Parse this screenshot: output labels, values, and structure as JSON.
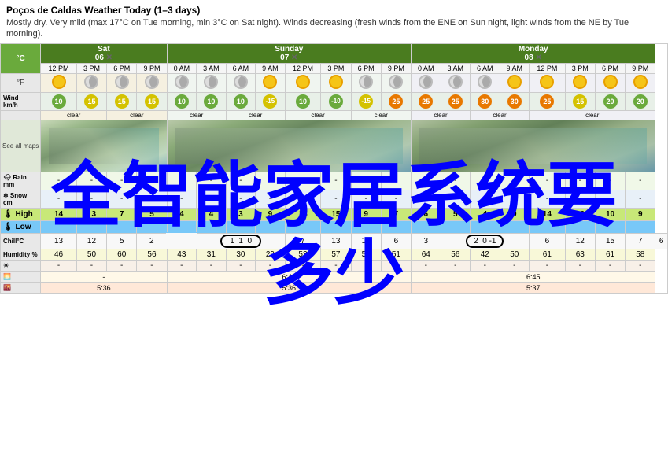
{
  "header": {
    "title": "Poços de Caldas Weather Today (1–3 days)",
    "description": "Mostly dry. Very mild (max 17°C on Tue morning, min 3°C on Sat night). Winds decreasing (fresh winds from the ENE on Sun night, light winds from the NE by Tue morning)."
  },
  "units": {
    "celsius": "°C",
    "fahrenheit": "°F"
  },
  "days": [
    {
      "name": "Sat",
      "date": "06"
    },
    {
      "name": "Sunday",
      "date": "07"
    },
    {
      "name": "Monday",
      "date": "08"
    }
  ],
  "sat_times": [
    "12 PM",
    "3 PM",
    "6 PM",
    "9 PM"
  ],
  "sun_times": [
    "0 AM",
    "3 AM",
    "6 AM",
    "9 AM",
    "12 PM",
    "3 PM",
    "6 PM",
    "9 PM"
  ],
  "mon_times": [
    "0 AM",
    "3 AM",
    "6 AM",
    "9 AM",
    "12 PM",
    "3 PM",
    "6 PM",
    "9 PM"
  ],
  "wind_sat": [
    "10",
    "15",
    "15",
    "15"
  ],
  "wind_sun": [
    "10",
    "10",
    "10",
    "-15",
    "10",
    "-10",
    "-15",
    "25"
  ],
  "wind_mon": [
    "25",
    "25",
    "30",
    "30",
    "25",
    "15",
    "20",
    "20"
  ],
  "rain_sat": [
    "-",
    "-",
    "-",
    "-"
  ],
  "rain_sun": [
    "-",
    "-",
    "-",
    "-",
    "-",
    "-",
    "-",
    "-"
  ],
  "rain_mon": [
    "-",
    "-",
    "-",
    "-",
    "-",
    "-",
    "-",
    "-"
  ],
  "snow_sat": [
    "-",
    "-",
    "-",
    "-"
  ],
  "snow_sun": [
    "-",
    "-",
    "-",
    "-",
    "-",
    "-",
    "-",
    "-"
  ],
  "snow_mon": [
    "-",
    "-",
    "-",
    "-",
    "-",
    "-",
    "-",
    "-"
  ],
  "high_sat": [
    "14",
    "13",
    "7",
    "5"
  ],
  "high_sun": [
    "4",
    "4",
    "3",
    "9",
    "14",
    "15",
    "9",
    "7"
  ],
  "high_mon": [
    "6",
    "5",
    "4",
    "9",
    "14",
    "16",
    "10",
    "9"
  ],
  "low_sat": [],
  "low_sun": [],
  "low_mon": [],
  "chill_sat": [
    "13",
    "12",
    "5",
    "2"
  ],
  "chill_sun": [
    "1",
    "1",
    "0",
    "7",
    "13",
    "14",
    "6",
    "3"
  ],
  "chill_mon": [
    "2",
    "0",
    "-1",
    "6",
    "12",
    "15",
    "7",
    "6"
  ],
  "humid_sat": [
    "46",
    "50",
    "60",
    "56"
  ],
  "humid_sun": [
    "43",
    "31",
    "30",
    "29",
    "53",
    "57",
    "57",
    "51"
  ],
  "humid_mon": [
    "64",
    "56",
    "42",
    "50",
    "61",
    "63",
    "61",
    "58"
  ],
  "sunrise_sat": "",
  "sunrise_sun": "6:45",
  "sunrise_mon": "6:45",
  "sunset_sat": "5:36",
  "sunset_sun": "5:36",
  "sunset_mon": "5:37",
  "see_all_maps": "See all maps",
  "overlay": "全智能家居系统要\n多少"
}
